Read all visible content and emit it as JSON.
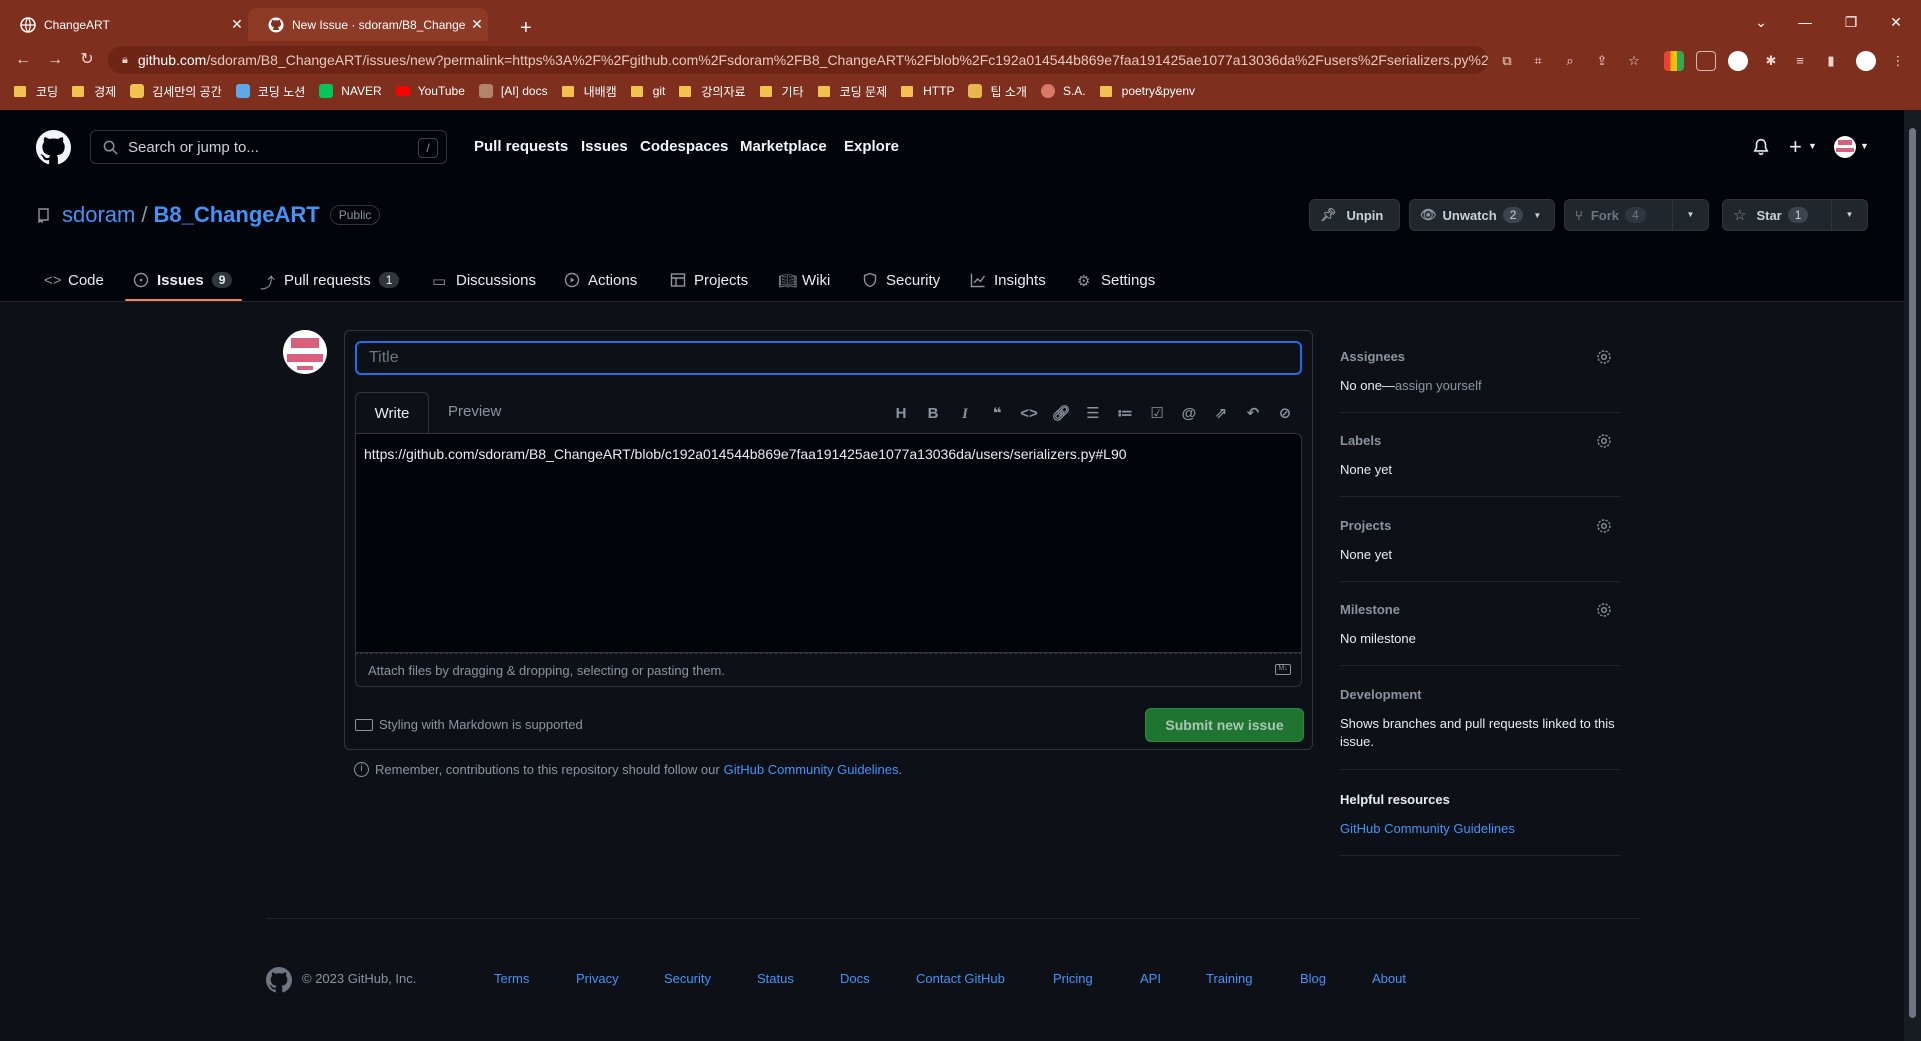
{
  "browser": {
    "tabs": [
      {
        "title": "ChangeART"
      },
      {
        "title": "New Issue · sdoram/B8_Change"
      }
    ],
    "url_host": "github.com",
    "url_rest": "/sdoram/B8_ChangeART/issues/new?permalink=https%3A%2F%2Fgithub.com%2Fsdoram%2FB8_ChangeART%2Fblob%2Fc192a014544b869e7faa191425ae1077a13036da%2Fusers%2Fserializers.py%2...",
    "bookmarks": [
      {
        "label": "코딩",
        "kind": "folder"
      },
      {
        "label": "경제",
        "kind": "folder"
      },
      {
        "label": "김세만의 공간",
        "kind": "home"
      },
      {
        "label": "코딩 노션",
        "kind": "notion"
      },
      {
        "label": "NAVER",
        "kind": "naver"
      },
      {
        "label": "YouTube",
        "kind": "youtube"
      },
      {
        "label": "[AI] docs",
        "kind": "ai"
      },
      {
        "label": "내배캠",
        "kind": "folder"
      },
      {
        "label": "git",
        "kind": "folder"
      },
      {
        "label": "강의자료",
        "kind": "folder"
      },
      {
        "label": "기타",
        "kind": "folder"
      },
      {
        "label": "코딩 문제",
        "kind": "folder"
      },
      {
        "label": "HTTP",
        "kind": "folder"
      },
      {
        "label": "팁 소개",
        "kind": "tip"
      },
      {
        "label": "S.A.",
        "kind": "sa"
      },
      {
        "label": "poetry&pyenv",
        "kind": "folder"
      }
    ]
  },
  "header": {
    "search_placeholder": "Search or jump to...",
    "search_shortcut": "/",
    "nav": [
      "Pull requests",
      "Issues",
      "Codespaces",
      "Marketplace",
      "Explore"
    ]
  },
  "repo": {
    "owner": "sdoram",
    "sep": "/",
    "name": "B8_ChangeART",
    "visibility": "Public",
    "buttons": {
      "unpin": "Unpin",
      "unwatch": "Unwatch",
      "unwatch_count": "2",
      "fork": "Fork",
      "fork_count": "4",
      "star": "Star",
      "star_count": "1"
    },
    "tabs": {
      "code": "Code",
      "issues": "Issues",
      "issues_count": "9",
      "pulls": "Pull requests",
      "pulls_count": "1",
      "discussions": "Discussions",
      "actions": "Actions",
      "projects": "Projects",
      "wiki": "Wiki",
      "security": "Security",
      "insights": "Insights",
      "settings": "Settings"
    }
  },
  "form": {
    "title_placeholder": "Title",
    "write_tab": "Write",
    "preview_tab": "Preview",
    "body": "https://github.com/sdoram/B8_ChangeART/blob/c192a014544b869e7faa191425ae1077a13036da/users/serializers.py#L90",
    "attach_hint": "Attach files by dragging & dropping, selecting or pasting them.",
    "markdown_note": "Styling with Markdown is supported",
    "submit": "Submit new issue",
    "remember_text": "Remember, contributions to this repository should follow our",
    "remember_link": "GitHub Community Guidelines",
    "remember_end": "."
  },
  "sidebar": {
    "assignees": {
      "label": "Assignees",
      "value": "No one—",
      "link": "assign yourself"
    },
    "labels": {
      "label": "Labels",
      "value": "None yet"
    },
    "projects": {
      "label": "Projects",
      "value": "None yet"
    },
    "milestone": {
      "label": "Milestone",
      "value": "No milestone"
    },
    "development": {
      "label": "Development",
      "value": "Shows branches and pull requests linked to this issue."
    },
    "helpful": {
      "label": "Helpful resources",
      "link": "GitHub Community Guidelines"
    }
  },
  "footer": {
    "copyright": "© 2023 GitHub, Inc.",
    "links": [
      "Terms",
      "Privacy",
      "Security",
      "Status",
      "Docs",
      "Contact GitHub",
      "Pricing",
      "API",
      "Training",
      "Blog",
      "About"
    ]
  },
  "colors": {
    "chrome": "#7f2f1d",
    "header_bg": "#010409",
    "page_bg": "#0d1117",
    "link": "#4493f8",
    "submit": "#238636",
    "issues_underline": "#f78166"
  }
}
